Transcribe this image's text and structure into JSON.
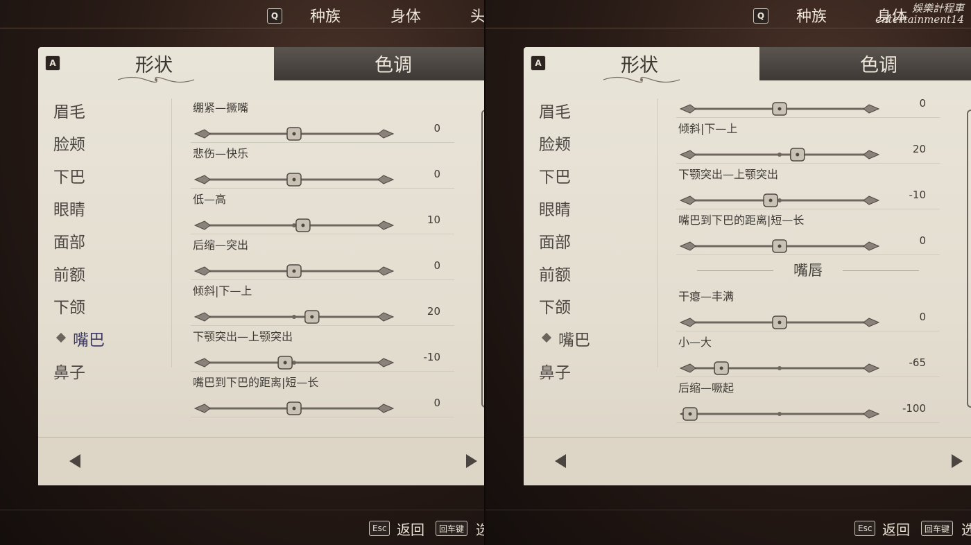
{
  "top_tabs": {
    "key": "Q",
    "items": [
      "种族",
      "身体",
      "头"
    ]
  },
  "segments": {
    "key": "A",
    "shape": "形状",
    "tone": "色调"
  },
  "categories": [
    "眉毛",
    "脸颊",
    "下巴",
    "眼睛",
    "面部",
    "前额",
    "下颌",
    "嘴巴",
    "鼻子"
  ],
  "active_category": "嘴巴",
  "panel_left": {
    "sliders": [
      {
        "label": "绷紧—撅嘴",
        "value": "0",
        "fraction": 0.5
      },
      {
        "label": "悲伤—快乐",
        "value": "0",
        "fraction": 0.5
      },
      {
        "label": "低—高",
        "value": "10",
        "fraction": 0.55
      },
      {
        "label": "后缩—突出",
        "value": "0",
        "fraction": 0.5
      },
      {
        "label": "倾斜|下—上",
        "value": "20",
        "fraction": 0.6
      },
      {
        "label": "下颚突出—上颚突出",
        "value": "-10",
        "fraction": 0.45
      },
      {
        "label": "嘴巴到下巴的距离|短—长",
        "value": "0",
        "fraction": 0.5
      }
    ]
  },
  "panel_right": {
    "first_value": "0",
    "sliders_a": [
      {
        "label": "倾斜|下—上",
        "value": "20",
        "fraction": 0.6
      },
      {
        "label": "下颚突出—上颚突出",
        "value": "-10",
        "fraction": 0.45
      },
      {
        "label": "嘴巴到下巴的距离|短—长",
        "value": "0",
        "fraction": 0.5
      }
    ],
    "section_title": "嘴唇",
    "sliders_b": [
      {
        "label": "干瘪—丰满",
        "value": "0",
        "fraction": 0.5
      },
      {
        "label": "小—大",
        "value": "-65",
        "fraction": 0.175
      },
      {
        "label": "后缩—噘起",
        "value": "-100",
        "fraction": 0.0
      }
    ]
  },
  "hints": {
    "back_key": "Esc",
    "back_label": "返回",
    "enter_key": "回车键",
    "enter_label": "选"
  },
  "watermark": {
    "line1": "娛樂計程車",
    "line2": "entertainment14"
  }
}
